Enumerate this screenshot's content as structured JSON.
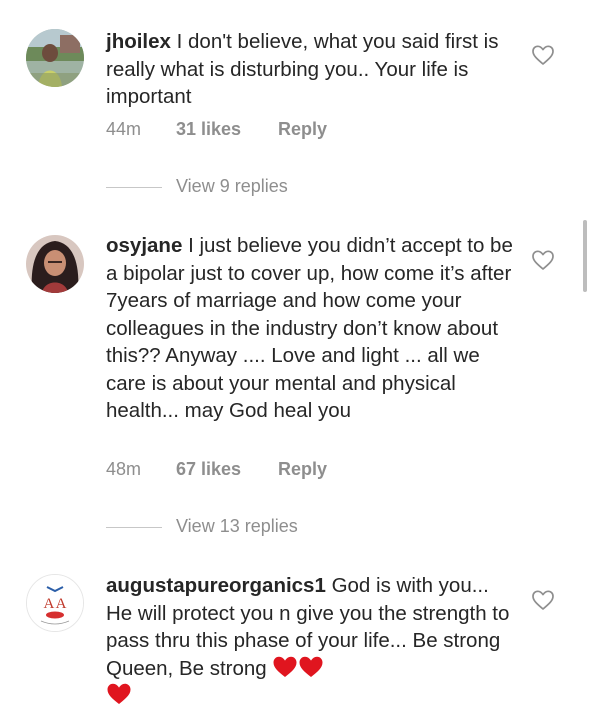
{
  "comments": [
    {
      "username": "jhoilex",
      "text": "I don't believe, what you said first is really what is disturbing you.. Your life is important",
      "time": "44m",
      "likes": "31 likes",
      "reply_label": "Reply",
      "view_replies": "View 9 replies"
    },
    {
      "username": "osyjane",
      "text": "I just believe you didn’t accept to be a bipolar just to cover up, how come it’s after 7years of marriage and how come your colleagues in the industry don’t know about this?? Anyway .... Love and light ... all we care is about your mental and physical health... may God heal you",
      "time": "48m",
      "likes": "67 likes",
      "reply_label": "Reply",
      "view_replies": "View 13 replies"
    },
    {
      "username": "augustapureorganics1",
      "text": "God is with you... He will protect you n give you the strength to pass thru this phase of your life... Be strong Queen, Be strong",
      "emoji": [
        "red-heart-emoji",
        "red-heart-emoji",
        "red-heart-emoji"
      ],
      "logo_text": "AA"
    }
  ],
  "colors": {
    "text": "#262626",
    "muted": "#8e8e8e",
    "heart_red": "#e0151f"
  },
  "icons": {
    "like": "heart-outline-icon"
  }
}
